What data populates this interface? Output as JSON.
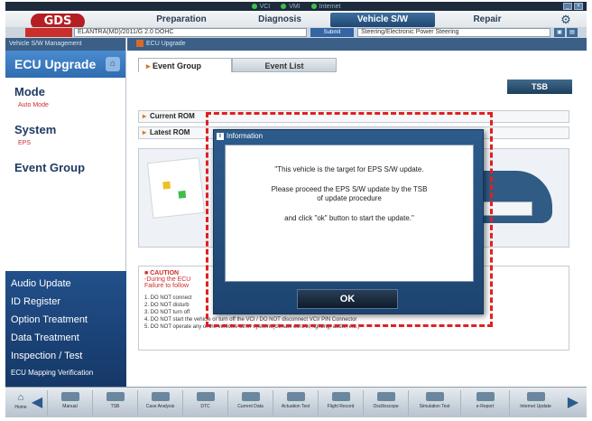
{
  "status": {
    "items": [
      "VCI",
      "VMI",
      "Internet"
    ]
  },
  "header": {
    "logo": "GDS",
    "tabs": [
      "Preparation",
      "Diagnosis",
      "Vehicle S/W Management",
      "Repair"
    ],
    "active_tab": "Vehicle S/W Management",
    "settings_icon": "gear-icon"
  },
  "vehicle_bar": {
    "type_label": "",
    "vehicle_value": "ELANTRA(MD)/2011/G 2.0 DOHC",
    "submit_label": "Submit",
    "system_value": "Steering/Electronic Power Steering"
  },
  "sidebar": {
    "header": "Vehicle S/W Management",
    "title": "ECU Upgrade",
    "mode_label": "Mode",
    "mode_value": "Auto Mode",
    "system_label": "System",
    "system_value": "EPS",
    "event_group_label": "Event Group",
    "event_group_value": "",
    "menu": [
      "Audio Update",
      "ID Register",
      "Option Treatment",
      "Data Treatment",
      "Inspection / Test",
      "ECU Mapping Verification"
    ]
  },
  "main": {
    "header": "ECU Upgrade",
    "tabs": [
      "Event Group",
      "Event List"
    ],
    "tsb_label": "TSB",
    "current_rom_label": "Current ROM",
    "latest_rom_label": "Latest ROM",
    "caution_title": "CAUTION",
    "caution_red_1": "-During the ECU",
    "caution_red_2": "Failure to follow",
    "caution_lines": [
      "1. DO NOT connect",
      "2. DO NOT disturb",
      "3. DO NOT turn off",
      "4. DO NOT start the vehicle or turn off the VCI / DO NOT disconnect VCI/ PIN Connector",
      "5. DO NOT operate any of the vehicles other systems(climate control, lighting, audio, etc.)"
    ]
  },
  "dialog": {
    "title": "Information",
    "line1": "\"This vehicle is the target for EPS S/W update.",
    "line2a": "Please proceed the EPS S/W update by the TSB",
    "line2b": "of update procedure",
    "line3": "and click \"ok\" button to start the update.\"",
    "ok_label": "OK"
  },
  "toolbar": {
    "home_label": "Home",
    "items": [
      "Manual",
      "TSB",
      "Case Analysis",
      "DTC",
      "Current Data",
      "Actuation Test",
      "Flight Record",
      "Oscilloscope",
      "Simulation Test",
      "e-Report",
      "Internet Update"
    ]
  },
  "colors": {
    "highlight": "#e02020",
    "accent": "#3465a4",
    "brand": "#b51f23"
  }
}
